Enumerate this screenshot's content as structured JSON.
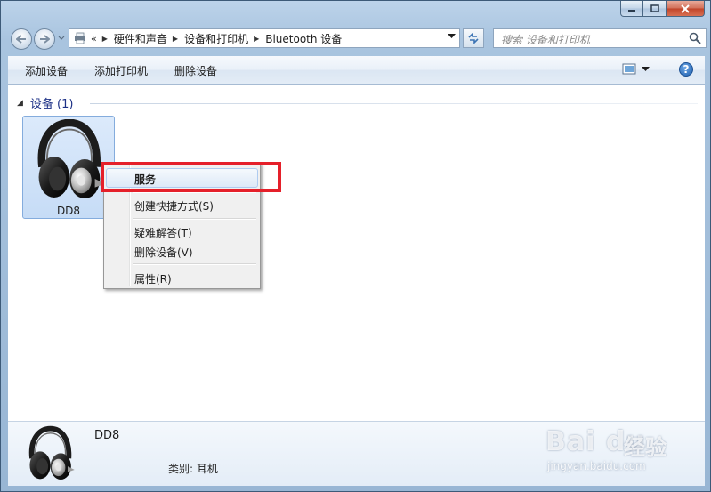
{
  "address": {
    "overflow": "«",
    "crumbs": [
      "硬件和声音",
      "设备和打印机",
      "Bluetooth 设备"
    ]
  },
  "search": {
    "placeholder": "搜索 设备和打印机"
  },
  "toolbar": {
    "add_device": "添加设备",
    "add_printer": "添加打印机",
    "remove_device": "删除设备",
    "help": "?"
  },
  "group": {
    "label": "设备 (1)"
  },
  "device": {
    "name": "DD8",
    "icon": "headphones-icon"
  },
  "context_menu": {
    "items": [
      "服务",
      "创建快捷方式(S)",
      "疑难解答(T)",
      "删除设备(V)",
      "属性(R)"
    ],
    "highlighted": "服务"
  },
  "details": {
    "name": "DD8",
    "category_label": "类别:",
    "category_value": "耳机"
  },
  "watermark": {
    "brand": "Bai du",
    "product": "经验",
    "url": "jingyan.baidu.com"
  },
  "colors": {
    "annotation_red": "#e5202a",
    "group_blue": "#1e3287",
    "selection": "#c6dcf6"
  }
}
